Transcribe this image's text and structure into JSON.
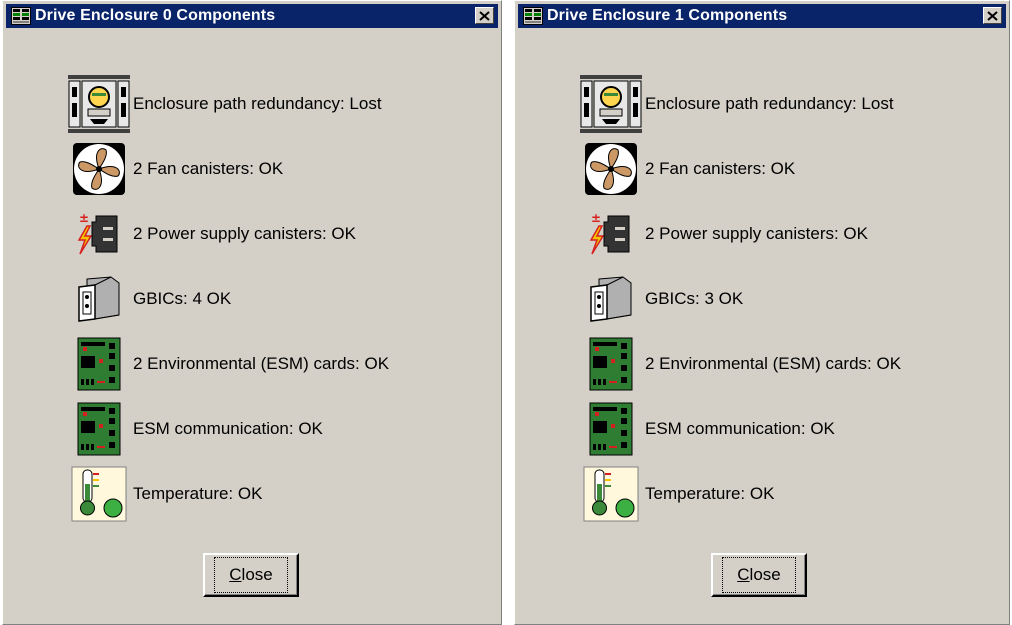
{
  "windows": [
    {
      "title": "Drive Enclosure 0 Components",
      "items": [
        {
          "icon": "enclosure-path-icon",
          "label": "Enclosure path redundancy: Lost"
        },
        {
          "icon": "fan-icon",
          "label": "2 Fan canisters: OK"
        },
        {
          "icon": "power-supply-icon",
          "label": "2 Power supply canisters: OK"
        },
        {
          "icon": "gbic-icon",
          "label": "GBICs: 4 OK"
        },
        {
          "icon": "esm-card-icon",
          "label": "2 Environmental (ESM) cards: OK"
        },
        {
          "icon": "esm-card-icon",
          "label": "ESM communication: OK"
        },
        {
          "icon": "thermometer-icon",
          "label": "Temperature: OK"
        }
      ],
      "close_label_first": "C",
      "close_label_rest": "lose"
    },
    {
      "title": "Drive Enclosure 1 Components",
      "items": [
        {
          "icon": "enclosure-path-icon",
          "label": "Enclosure path redundancy: Lost"
        },
        {
          "icon": "fan-icon",
          "label": "2 Fan canisters: OK"
        },
        {
          "icon": "power-supply-icon",
          "label": "2 Power supply canisters: OK"
        },
        {
          "icon": "gbic-icon",
          "label": "GBICs: 3 OK"
        },
        {
          "icon": "esm-card-icon",
          "label": "2 Environmental (ESM) cards: OK"
        },
        {
          "icon": "esm-card-icon",
          "label": "ESM communication: OK"
        },
        {
          "icon": "thermometer-icon",
          "label": "Temperature: OK"
        }
      ],
      "close_label_first": "C",
      "close_label_rest": "lose"
    }
  ],
  "colors": {
    "titlebar": "#0a246a",
    "window_bg": "#d4d0c8",
    "esm_green": "#2e7d32",
    "power_red": "#d62020",
    "power_yellow": "#f5c400"
  }
}
